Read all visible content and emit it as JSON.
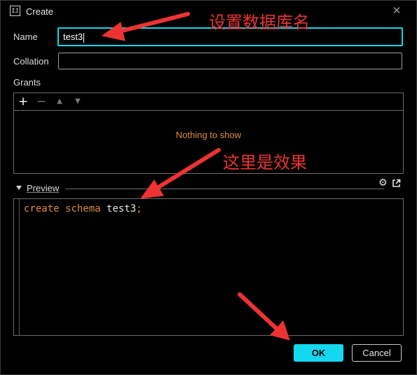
{
  "window": {
    "title": "Create",
    "icon_text": "IJ"
  },
  "form": {
    "name_label": "Name",
    "name_value": "test3",
    "collation_label": "Collation",
    "collation_value": "",
    "grants_label": "Grants"
  },
  "grants": {
    "empty_text": "Nothing to show",
    "toolbar": [
      "add-icon",
      "remove-icon",
      "move-up-icon",
      "move-down-icon"
    ]
  },
  "preview": {
    "label": "Preview",
    "code": {
      "kw1": "create",
      "kw2": "schema",
      "identifier": "test3",
      "terminator": ";"
    }
  },
  "buttons": {
    "ok": "OK",
    "cancel": "Cancel"
  },
  "annotations": {
    "name_note": "设置数据库名",
    "preview_note": "这里是效果"
  },
  "colors": {
    "accent": "#13d8ef",
    "keyword": "#e0873c",
    "annotation": "#ee3333"
  }
}
